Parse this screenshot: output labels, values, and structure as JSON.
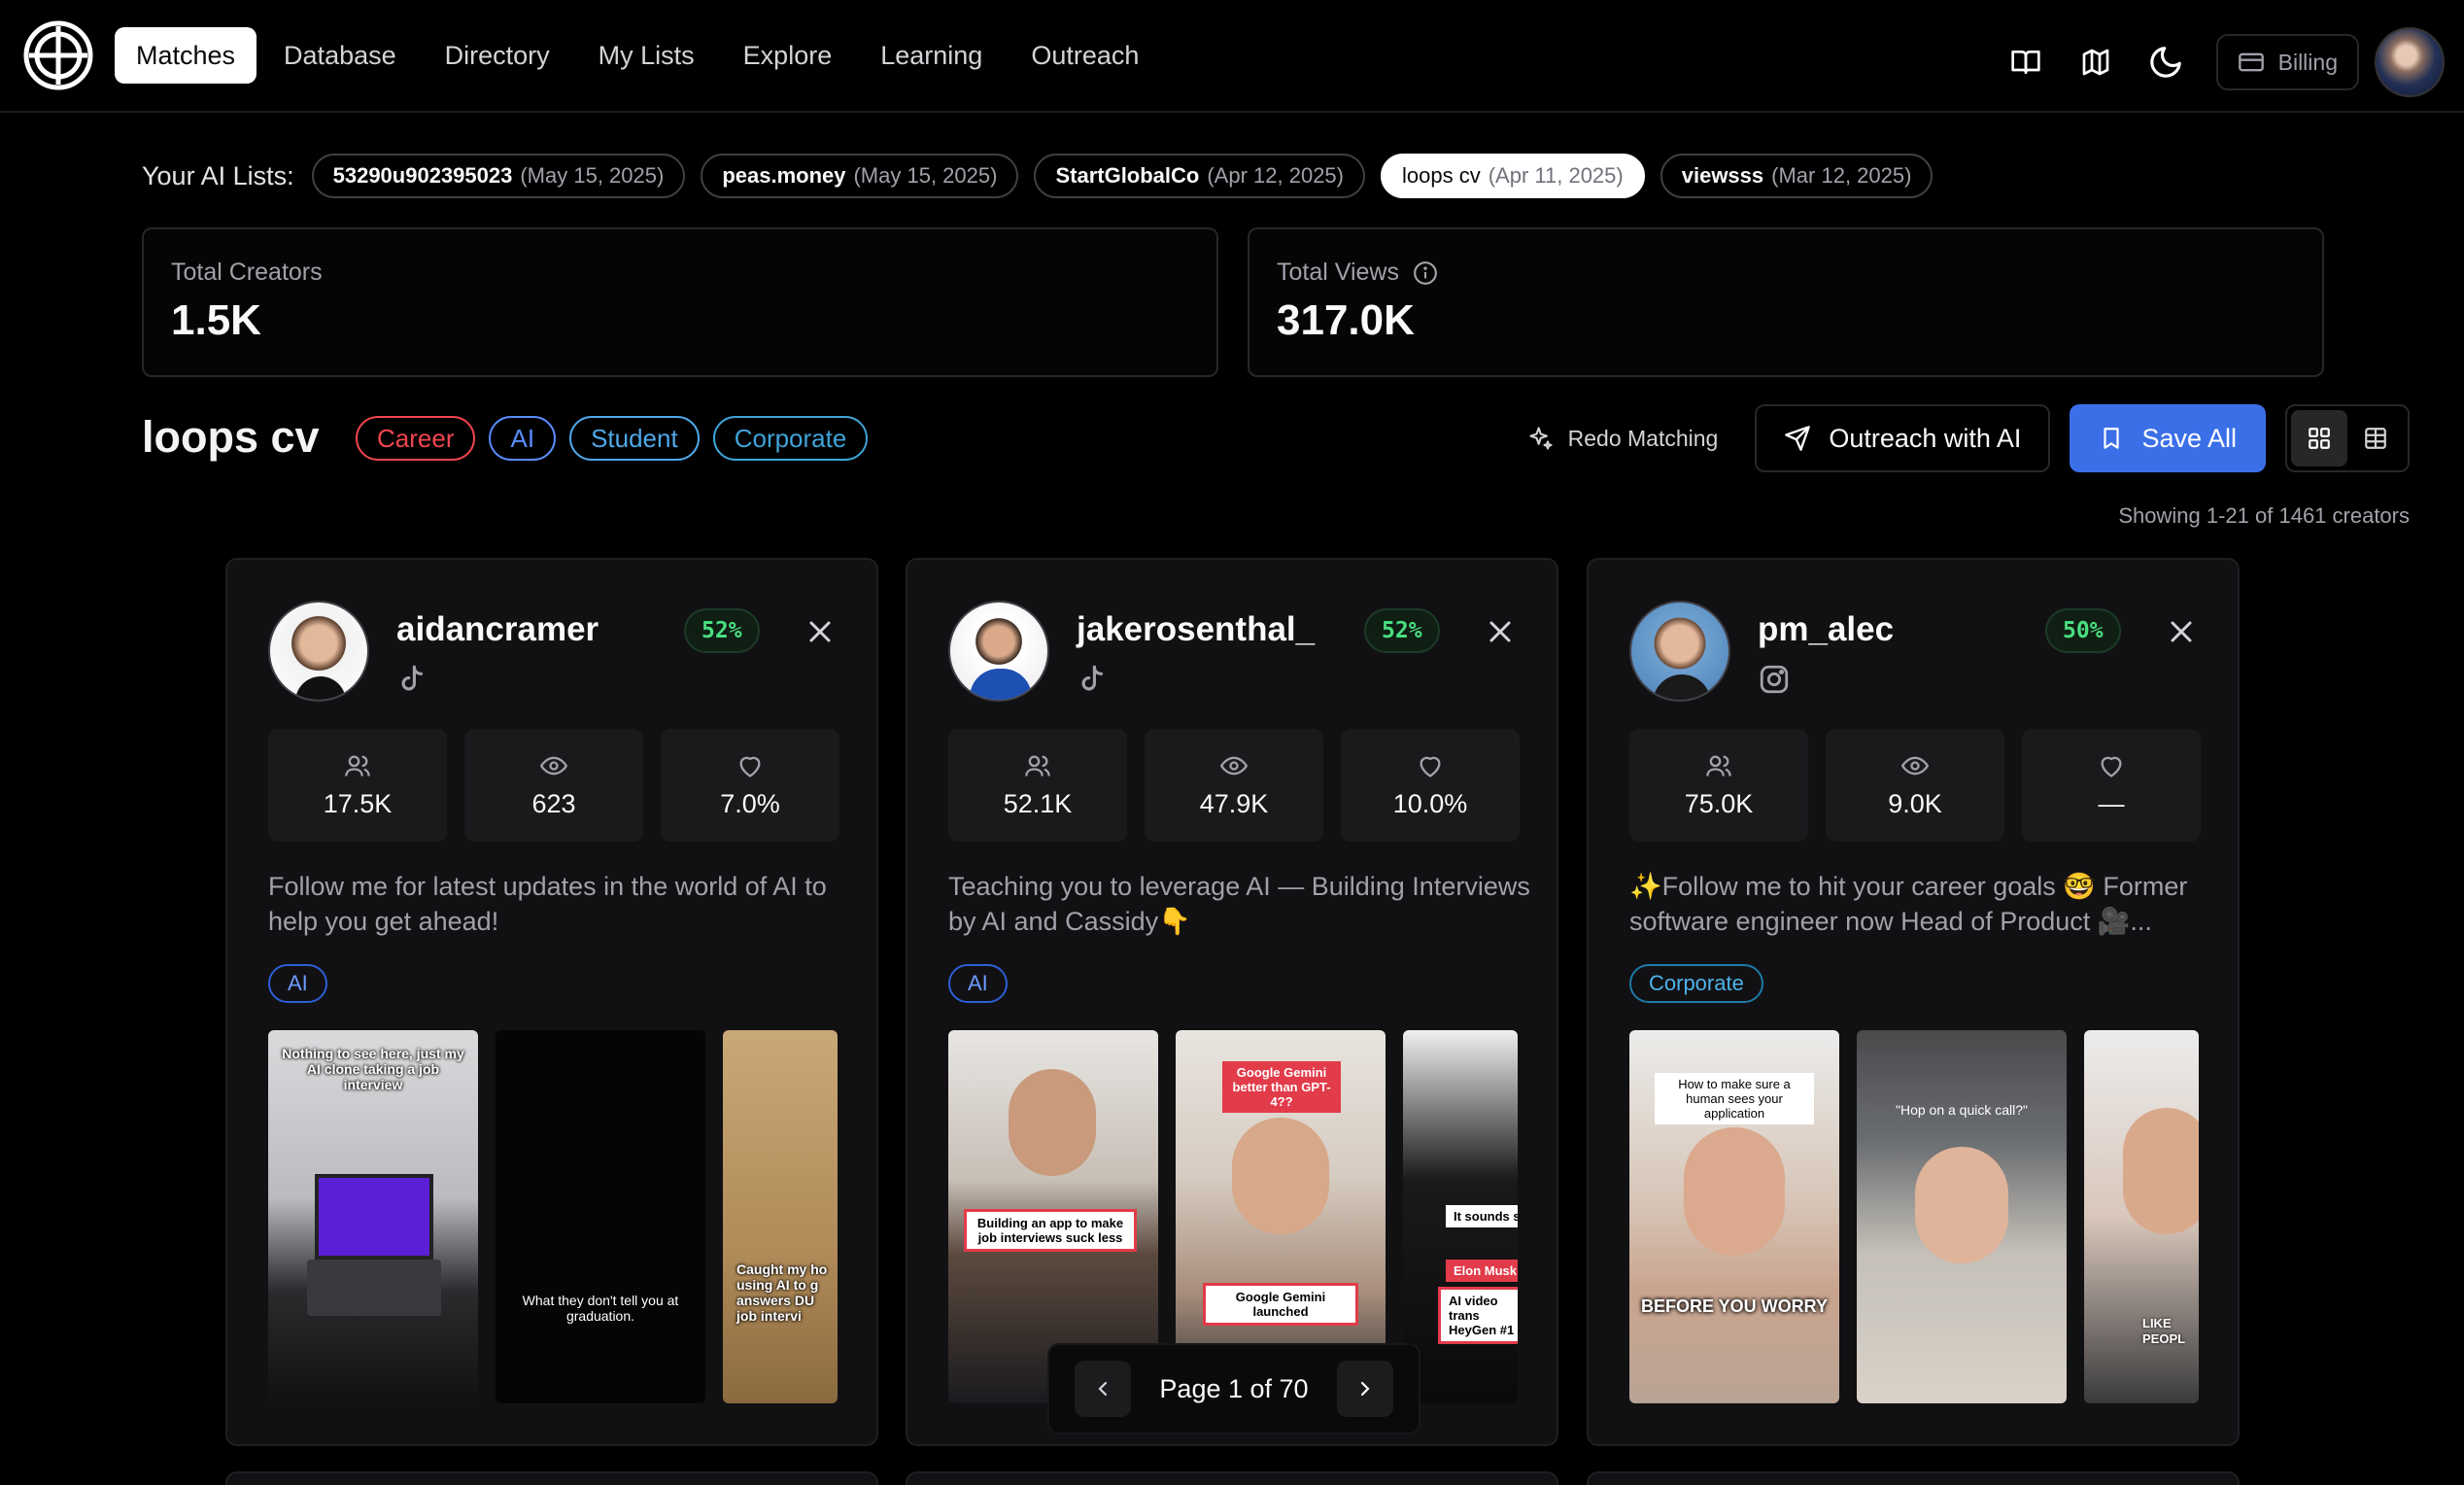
{
  "nav": {
    "tabs": [
      {
        "label": "Matches",
        "active": true
      },
      {
        "label": "Database"
      },
      {
        "label": "Directory"
      },
      {
        "label": "My Lists"
      },
      {
        "label": "Explore"
      },
      {
        "label": "Learning"
      },
      {
        "label": "Outreach"
      }
    ],
    "billing_label": "Billing",
    "icons": [
      "book-open-icon",
      "map-icon",
      "moon-icon",
      "credit-card-icon"
    ]
  },
  "ai_lists": {
    "label": "Your AI Lists:",
    "items": [
      {
        "name": "53290u902395023",
        "date": "(May 15, 2025)"
      },
      {
        "name": "peas.money",
        "date": "(May 15, 2025)"
      },
      {
        "name": "StartGlobalCo",
        "date": "(Apr 12, 2025)"
      },
      {
        "name": "loops cv",
        "date": "(Apr 11, 2025)",
        "active": true
      },
      {
        "name": "viewsss",
        "date": "(Mar 12, 2025)"
      }
    ]
  },
  "stats": {
    "total_creators": {
      "label": "Total Creators",
      "value": "1.5K"
    },
    "total_views": {
      "label": "Total Views",
      "value": "317.0K"
    }
  },
  "list": {
    "title": "loops cv",
    "tags": [
      {
        "label": "Career",
        "color": "#f0454f"
      },
      {
        "label": "AI",
        "color": "#5b8cff"
      },
      {
        "label": "Student",
        "color": "#4fa8e8"
      },
      {
        "label": "Corporate",
        "color": "#3fa3d8"
      }
    ],
    "redo_label": "Redo Matching",
    "outreach_label": "Outreach with AI",
    "save_label": "Save All",
    "showing": "Showing 1-21 of 1461 creators"
  },
  "cards": [
    {
      "name": "aidancramer",
      "platform": "tiktok-icon",
      "match": "52%",
      "followers": "17.5K",
      "views": "623",
      "engagement": "7.0%",
      "bio": "Follow me for latest updates in the world of AI to help you get ahead!",
      "tag": "AI",
      "thumbs": [
        {
          "caption": "Nothing to see here, just my AI clone taking a job interview"
        },
        {
          "caption": "What they don't tell you at graduation."
        },
        {
          "caption": "Caught my ho using AI to g answers DU job intervi"
        }
      ]
    },
    {
      "name": "jakerosenthal_",
      "platform": "tiktok-icon",
      "match": "52%",
      "followers": "52.1K",
      "views": "47.9K",
      "engagement": "10.0%",
      "bio": "Teaching you to leverage AI — Building Interviews by AI and Cassidy👇",
      "tag": "AI",
      "thumbs": [
        {
          "caption": "Building an app to make job interviews suck less"
        },
        {
          "caption": "Google Gemini better than GPT-4??",
          "caption2": "Google Gemini launched"
        },
        {
          "caption": "It sounds s",
          "caption2": "Elon Musk",
          "caption3": "AI video trans HeyGen #1"
        }
      ]
    },
    {
      "name": "pm_alec",
      "platform": "instagram-icon",
      "match": "50%",
      "followers": "75.0K",
      "views": "9.0K",
      "engagement": "—",
      "bio": "✨Follow me to hit your career goals 🤓 Former software engineer now Head of Product 🎥...",
      "tag": "Corporate",
      "thumbs": [
        {
          "caption": "How to make sure a human sees your application",
          "caption2": "BEFORE YOU WORRY"
        },
        {
          "caption": "\"Hop on a quick call?\""
        },
        {
          "caption": "LIKE PEOPL"
        }
      ]
    }
  ],
  "pagination": {
    "text": "Page 1 of 70"
  }
}
